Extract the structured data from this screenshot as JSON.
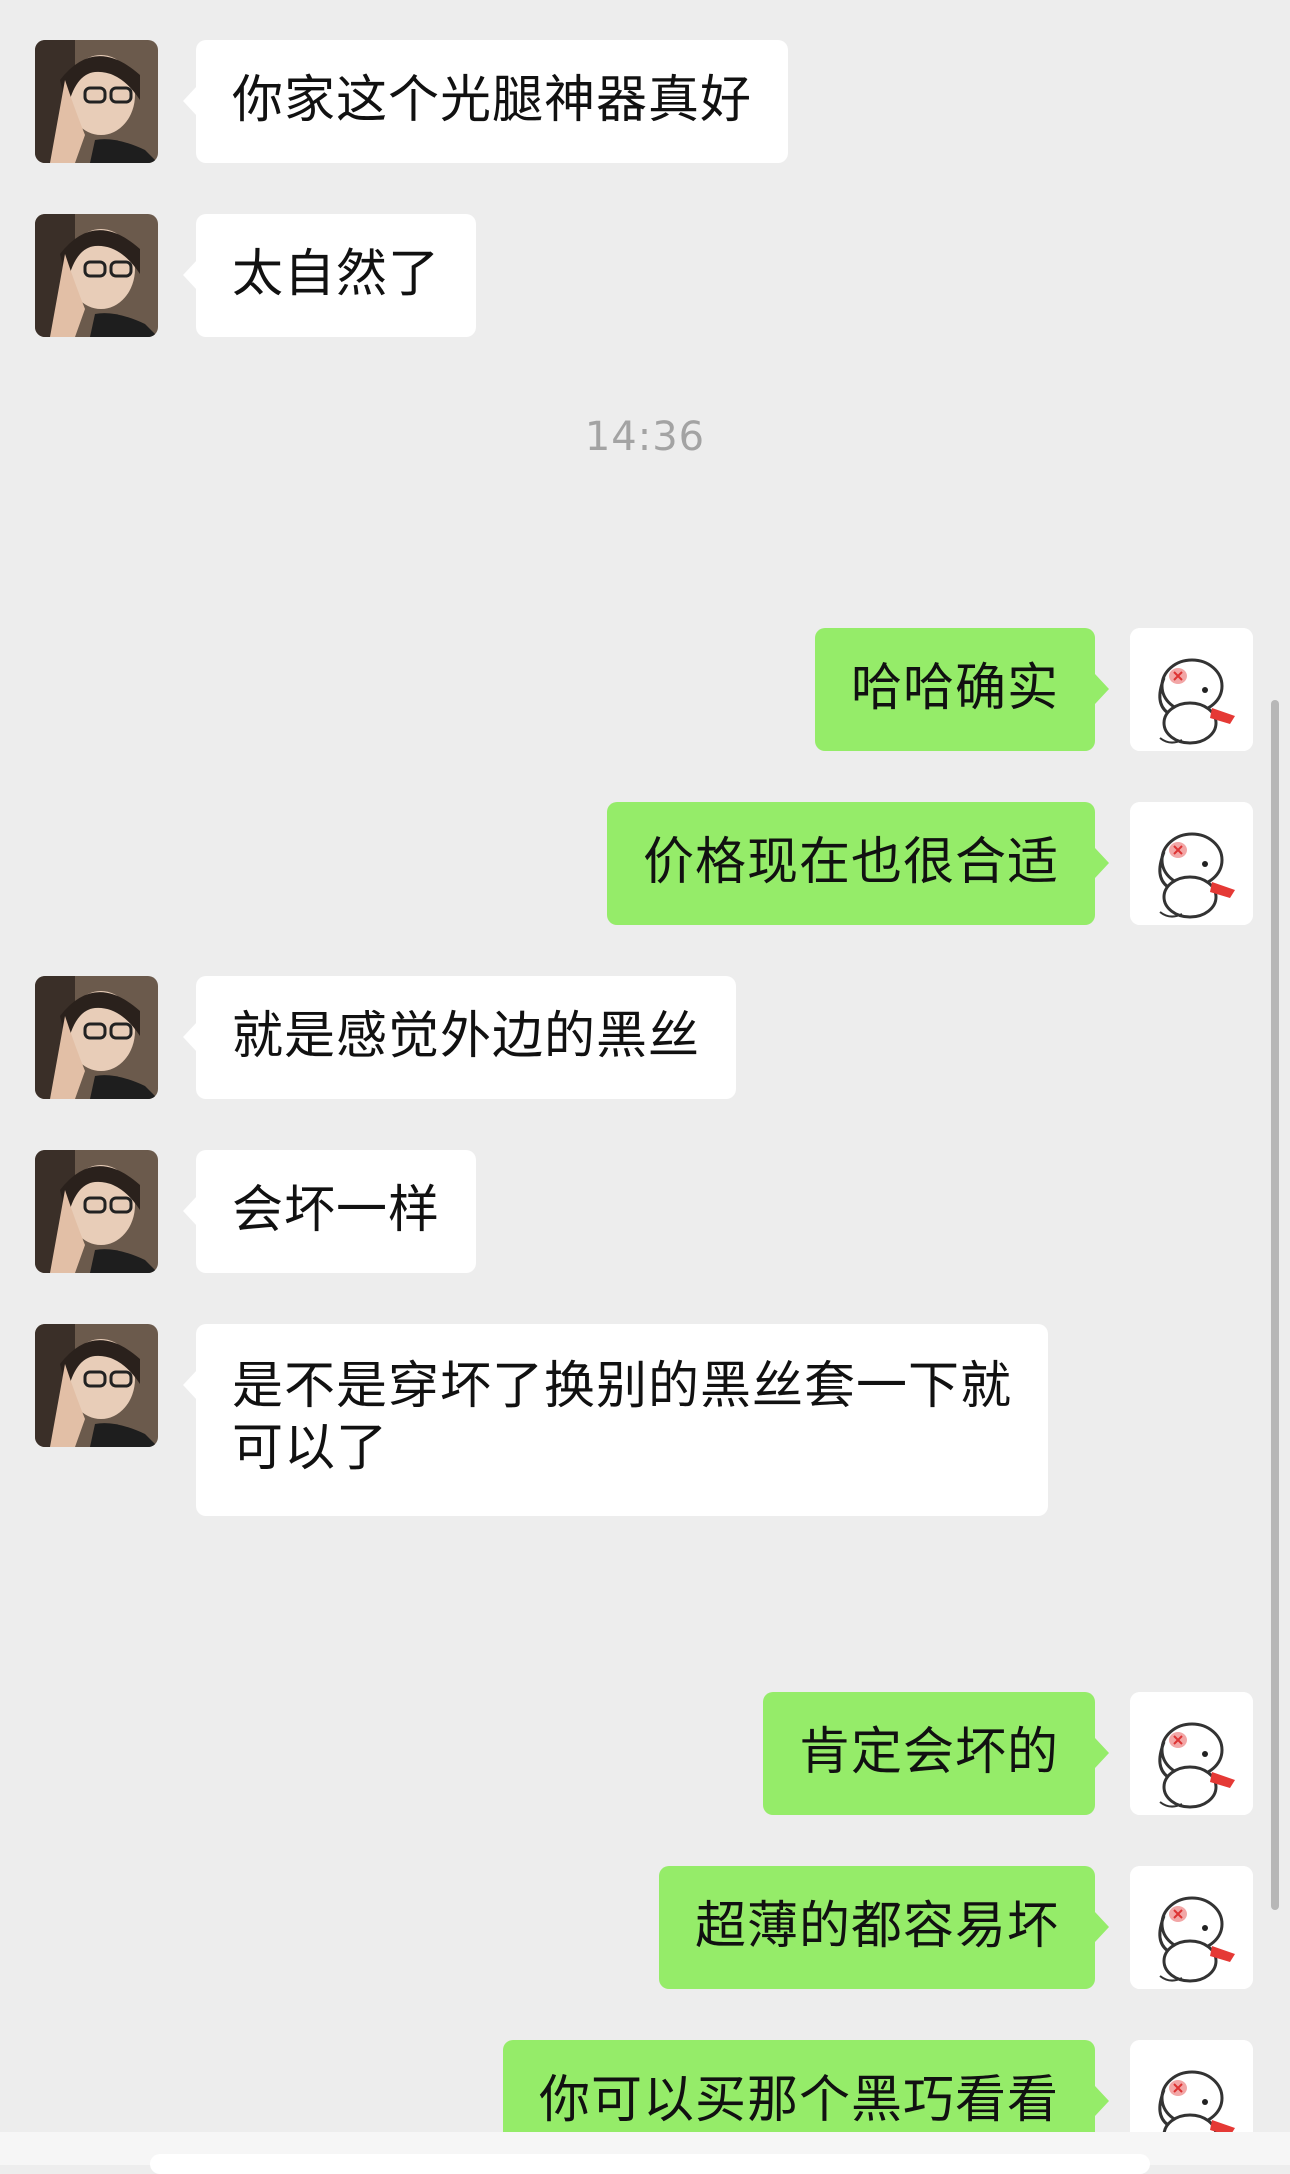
{
  "colors": {
    "background": "#EDEDED",
    "incoming_bubble": "#FFFFFF",
    "outgoing_bubble": "#95EC69",
    "timestamp_text": "#A3A3A3"
  },
  "timestamp": "14:36",
  "messages": [
    {
      "side": "incoming",
      "text": "你家这个光腿神器真好"
    },
    {
      "side": "incoming",
      "text": "太自然了"
    },
    {
      "side": "outgoing",
      "text": "哈哈确实"
    },
    {
      "side": "outgoing",
      "text": "价格现在也很合适"
    },
    {
      "side": "incoming",
      "text": "就是感觉外边的黑丝"
    },
    {
      "side": "incoming",
      "text": "会坏一样"
    },
    {
      "side": "incoming",
      "text": "是不是穿坏了换别的黑丝套一下就可以了"
    },
    {
      "side": "outgoing",
      "text": "肯定会坏的"
    },
    {
      "side": "outgoing",
      "text": "超薄的都容易坏"
    },
    {
      "side": "outgoing",
      "text": "你可以买那个黑巧看看"
    }
  ]
}
